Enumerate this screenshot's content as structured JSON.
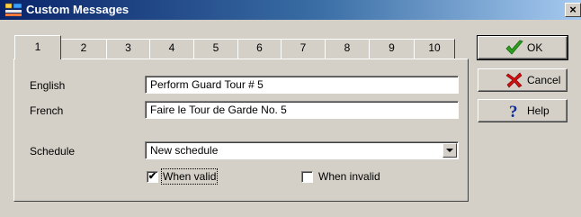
{
  "window": {
    "title": "Custom Messages",
    "close_glyph": "×"
  },
  "tabs": [
    "1",
    "2",
    "3",
    "4",
    "5",
    "6",
    "7",
    "8",
    "9",
    "10"
  ],
  "active_tab": "1",
  "form": {
    "english_label": "English",
    "english_value": "Perform Guard Tour # 5",
    "french_label": "French",
    "french_value": "Faire le Tour de Garde No. 5",
    "schedule_label": "Schedule",
    "schedule_value": "New schedule",
    "when_valid_label": "When valid",
    "when_valid_checked": true,
    "when_invalid_label": "When invalid",
    "when_invalid_checked": false,
    "check_glyph": "✔"
  },
  "buttons": {
    "ok_label": "OK",
    "cancel_label": "Cancel",
    "help_label": "Help"
  },
  "icons": {
    "app": "messages-app-icon",
    "ok": "green-check-icon",
    "cancel": "red-x-icon",
    "help": "question-mark-icon"
  },
  "colors": {
    "title_start": "#0a246a",
    "title_end": "#a6caf0",
    "ok": "#2e9e1f",
    "cancel": "#d01010",
    "help": "#0c2a9c"
  }
}
